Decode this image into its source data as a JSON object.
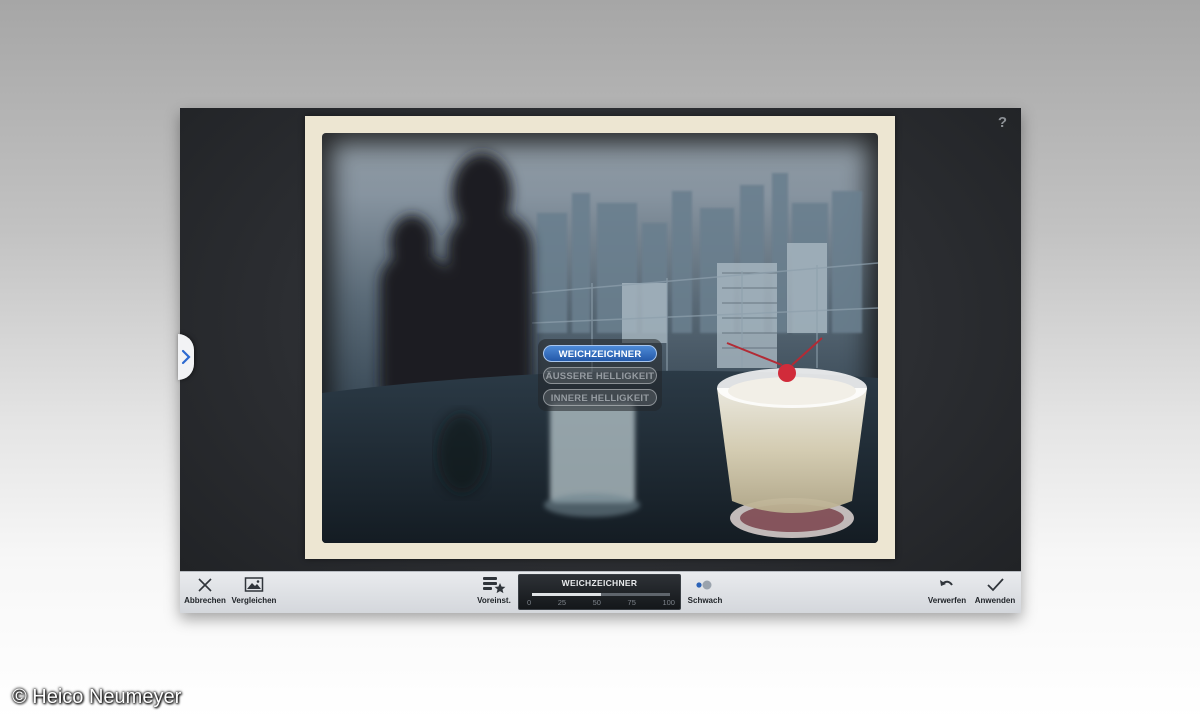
{
  "app": {
    "help_label": "?",
    "popup": {
      "items": [
        {
          "label": "WEICHZEICHNER",
          "active": true
        },
        {
          "label": "ÄUSSERE HELLIGKEIT",
          "active": false
        },
        {
          "label": "INNERE HELLIGKEIT",
          "active": false
        }
      ]
    },
    "toolbar": {
      "cancel_label": "Abbrechen",
      "compare_label": "Vergleichen",
      "presets_label": "Voreinst.",
      "strength_label": "Schwach",
      "undo_label": "Verwerfen",
      "apply_label": "Anwenden"
    },
    "slider": {
      "title": "WEICHZEICHNER",
      "ticks": [
        "0",
        "25",
        "50",
        "75",
        "100"
      ],
      "value_percent": 50
    },
    "icons": {
      "sidebar": "chevron-right-icon",
      "cancel": "close-icon",
      "compare": "image-icon",
      "presets": "presets-star-icon",
      "strength": "dots-icon",
      "undo": "undo-icon",
      "apply": "check-icon"
    },
    "colors": {
      "popup_active": "#2f6bc0",
      "toolbar_bg": "#dfe1e5"
    }
  },
  "watermark": {
    "text": "© Heico Neumeyer"
  }
}
